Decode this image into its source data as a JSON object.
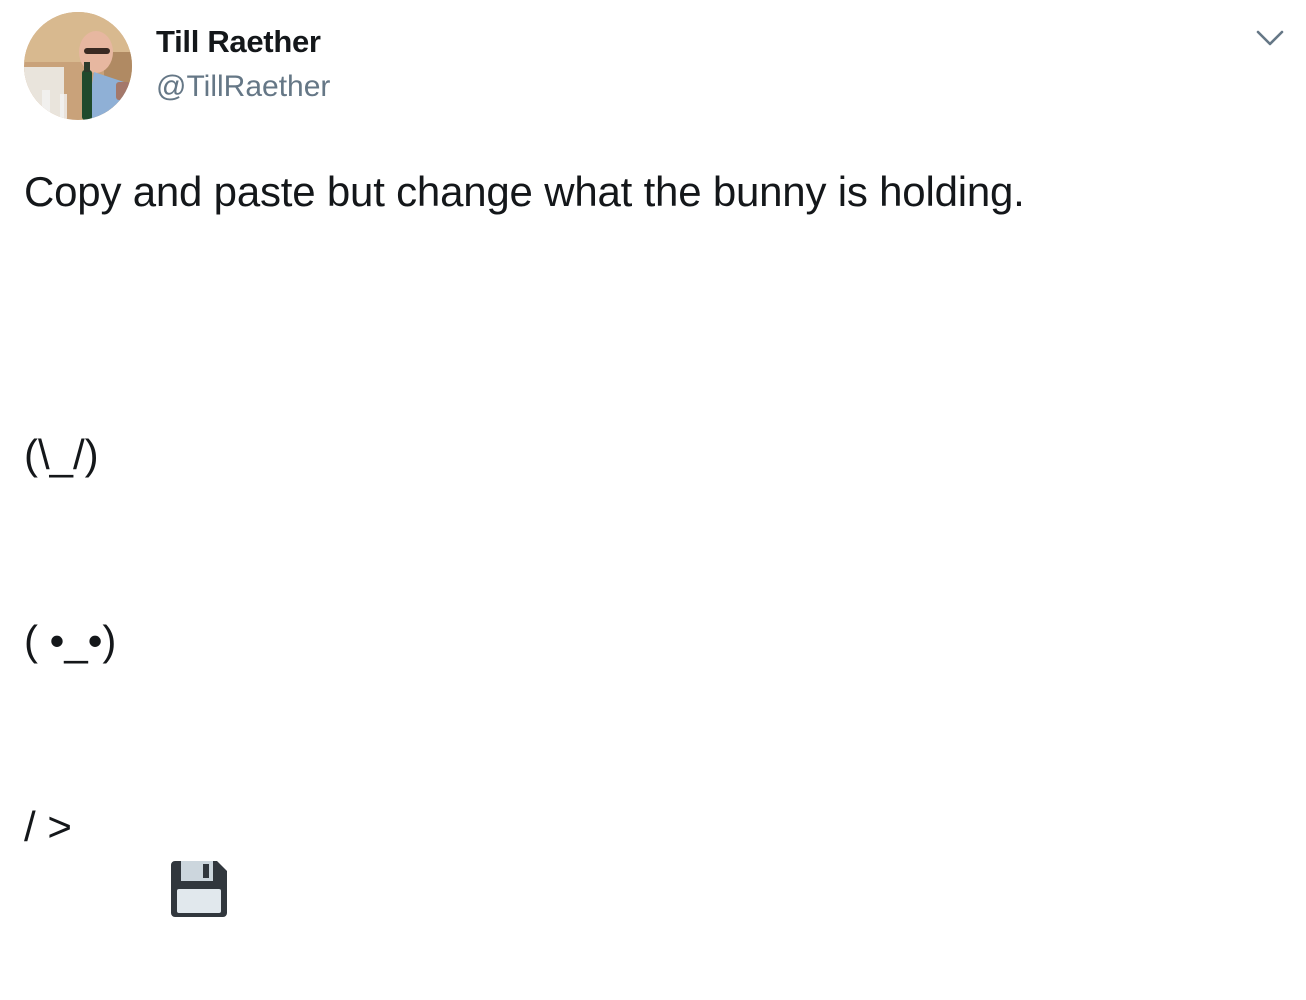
{
  "author": {
    "display_name": "Till Raether",
    "handle": "@TillRaether"
  },
  "menu": {
    "icon": "chevron-down-icon"
  },
  "tweet": {
    "text": "Copy and paste but change what the bunny is holding.",
    "bunny_lines": [
      "(\\_/)",
      "( •_•)",
      "/ >"
    ],
    "held_item_icon": "floppy-disk-icon"
  },
  "colors": {
    "text": "#14171a",
    "secondary": "#657786",
    "floppy_body": "#31373d",
    "floppy_label": "#ccd6dd"
  }
}
